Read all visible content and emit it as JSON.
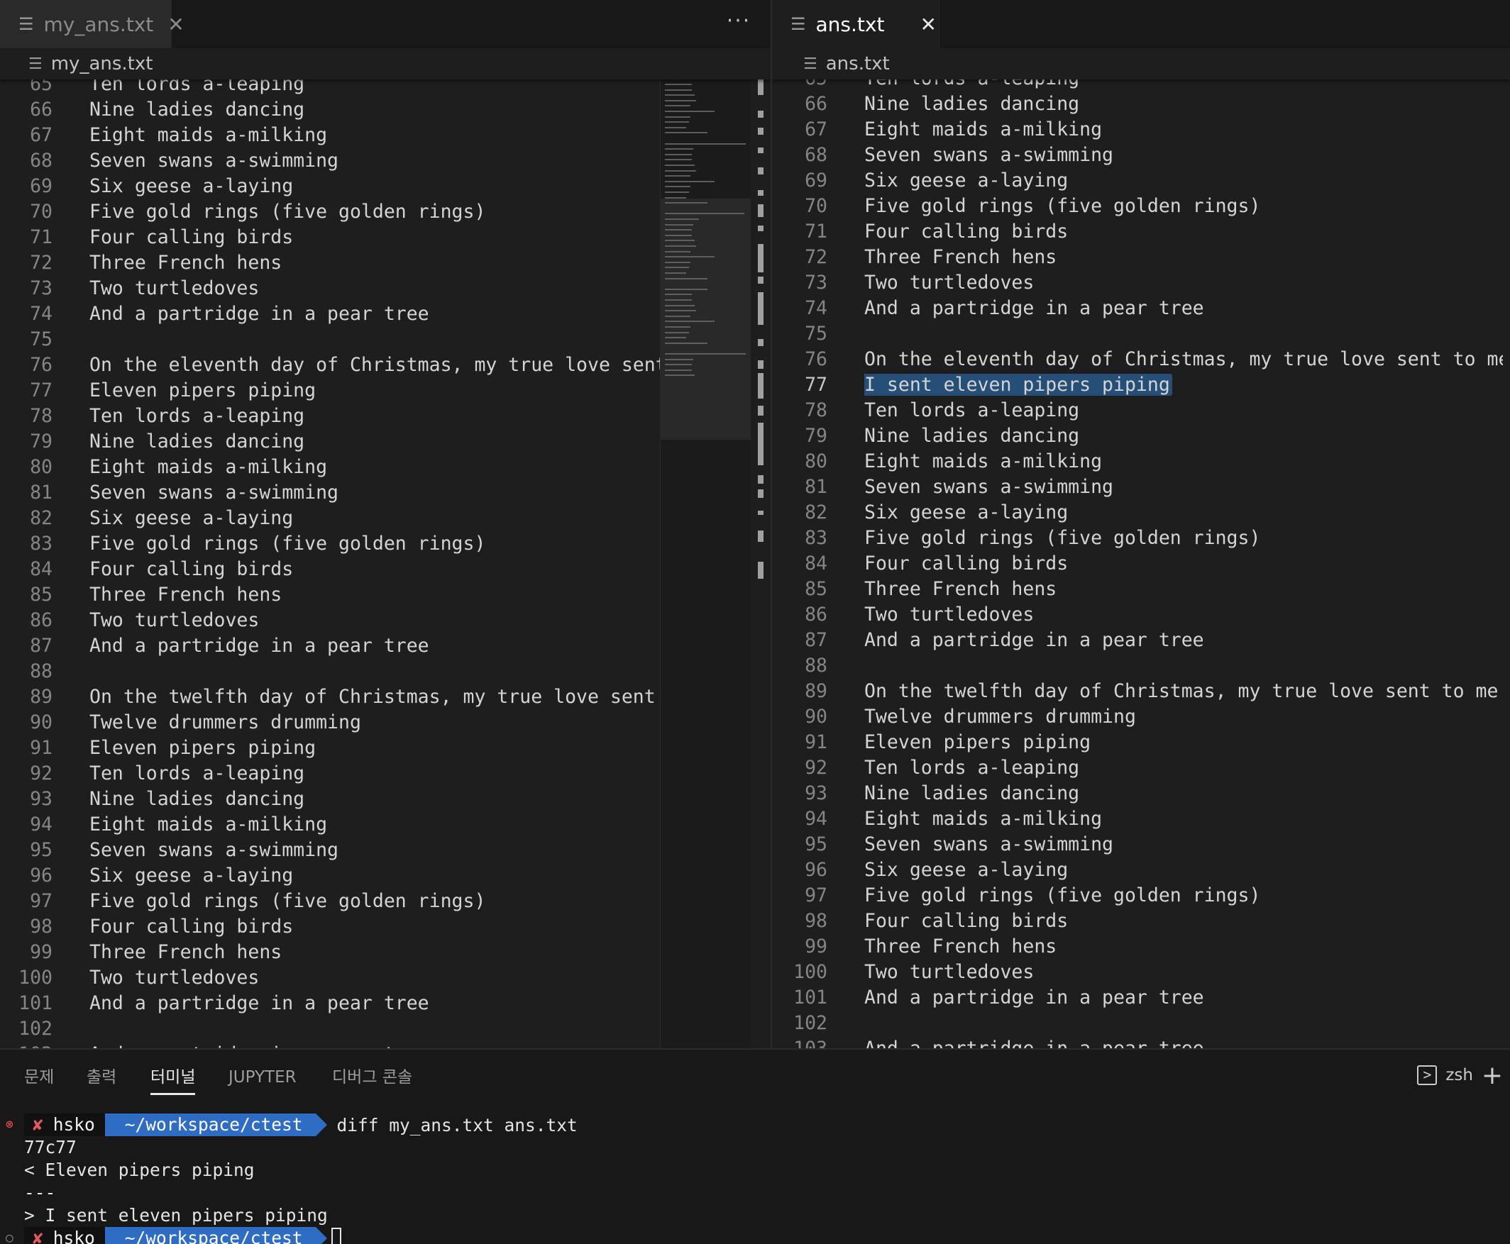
{
  "left": {
    "tab": {
      "filename": "my_ans.txt"
    },
    "breadcrumb": "my_ans.txt",
    "more_label": "···",
    "lines": [
      {
        "n": "65",
        "t": "Ten lords a-leaping"
      },
      {
        "n": "66",
        "t": "Nine ladies dancing"
      },
      {
        "n": "67",
        "t": "Eight maids a-milking"
      },
      {
        "n": "68",
        "t": "Seven swans a-swimming"
      },
      {
        "n": "69",
        "t": "Six geese a-laying"
      },
      {
        "n": "70",
        "t": "Five gold rings (five golden rings)"
      },
      {
        "n": "71",
        "t": "Four calling birds"
      },
      {
        "n": "72",
        "t": "Three French hens"
      },
      {
        "n": "73",
        "t": "Two turtledoves"
      },
      {
        "n": "74",
        "t": "And a partridge in a pear tree"
      },
      {
        "n": "75",
        "t": ""
      },
      {
        "n": "76",
        "t": "On the eleventh day of Christmas, my true love sent to me"
      },
      {
        "n": "77",
        "t": "Eleven pipers piping"
      },
      {
        "n": "78",
        "t": "Ten lords a-leaping"
      },
      {
        "n": "79",
        "t": "Nine ladies dancing"
      },
      {
        "n": "80",
        "t": "Eight maids a-milking"
      },
      {
        "n": "81",
        "t": "Seven swans a-swimming"
      },
      {
        "n": "82",
        "t": "Six geese a-laying"
      },
      {
        "n": "83",
        "t": "Five gold rings (five golden rings)"
      },
      {
        "n": "84",
        "t": "Four calling birds"
      },
      {
        "n": "85",
        "t": "Three French hens"
      },
      {
        "n": "86",
        "t": "Two turtledoves"
      },
      {
        "n": "87",
        "t": "And a partridge in a pear tree"
      },
      {
        "n": "88",
        "t": ""
      },
      {
        "n": "89",
        "t": "On the twelfth day of Christmas, my true love sent to me"
      },
      {
        "n": "90",
        "t": "Twelve drummers drumming"
      },
      {
        "n": "91",
        "t": "Eleven pipers piping"
      },
      {
        "n": "92",
        "t": "Ten lords a-leaping"
      },
      {
        "n": "93",
        "t": "Nine ladies dancing"
      },
      {
        "n": "94",
        "t": "Eight maids a-milking"
      },
      {
        "n": "95",
        "t": "Seven swans a-swimming"
      },
      {
        "n": "96",
        "t": "Six geese a-laying"
      },
      {
        "n": "97",
        "t": "Five gold rings (five golden rings)"
      },
      {
        "n": "98",
        "t": "Four calling birds"
      },
      {
        "n": "99",
        "t": "Three French hens"
      },
      {
        "n": "100",
        "t": "Two turtledoves"
      },
      {
        "n": "101",
        "t": "And a partridge in a pear tree"
      },
      {
        "n": "102",
        "t": ""
      },
      {
        "n": "103",
        "t": "And a partridge in a pear tree"
      }
    ]
  },
  "right": {
    "tab": {
      "filename": "ans.txt"
    },
    "breadcrumb": "ans.txt",
    "active_line": "77",
    "highlight_text": "I sent eleven pipers piping",
    "lines": [
      {
        "n": "65",
        "t": "Ten lords a-leaping"
      },
      {
        "n": "66",
        "t": "Nine ladies dancing"
      },
      {
        "n": "67",
        "t": "Eight maids a-milking"
      },
      {
        "n": "68",
        "t": "Seven swans a-swimming"
      },
      {
        "n": "69",
        "t": "Six geese a-laying"
      },
      {
        "n": "70",
        "t": "Five gold rings (five golden rings)"
      },
      {
        "n": "71",
        "t": "Four calling birds"
      },
      {
        "n": "72",
        "t": "Three French hens"
      },
      {
        "n": "73",
        "t": "Two turtledoves"
      },
      {
        "n": "74",
        "t": "And a partridge in a pear tree"
      },
      {
        "n": "75",
        "t": ""
      },
      {
        "n": "76",
        "t": "On the eleventh day of Christmas, my true love sent to me"
      },
      {
        "n": "77",
        "t": "I sent eleven pipers piping"
      },
      {
        "n": "78",
        "t": "Ten lords a-leaping"
      },
      {
        "n": "79",
        "t": "Nine ladies dancing"
      },
      {
        "n": "80",
        "t": "Eight maids a-milking"
      },
      {
        "n": "81",
        "t": "Seven swans a-swimming"
      },
      {
        "n": "82",
        "t": "Six geese a-laying"
      },
      {
        "n": "83",
        "t": "Five gold rings (five golden rings)"
      },
      {
        "n": "84",
        "t": "Four calling birds"
      },
      {
        "n": "85",
        "t": "Three French hens"
      },
      {
        "n": "86",
        "t": "Two turtledoves"
      },
      {
        "n": "87",
        "t": "And a partridge in a pear tree"
      },
      {
        "n": "88",
        "t": ""
      },
      {
        "n": "89",
        "t": "On the twelfth day of Christmas, my true love sent to me"
      },
      {
        "n": "90",
        "t": "Twelve drummers drumming"
      },
      {
        "n": "91",
        "t": "Eleven pipers piping"
      },
      {
        "n": "92",
        "t": "Ten lords a-leaping"
      },
      {
        "n": "93",
        "t": "Nine ladies dancing"
      },
      {
        "n": "94",
        "t": "Eight maids a-milking"
      },
      {
        "n": "95",
        "t": "Seven swans a-swimming"
      },
      {
        "n": "96",
        "t": "Six geese a-laying"
      },
      {
        "n": "97",
        "t": "Five gold rings (five golden rings)"
      },
      {
        "n": "98",
        "t": "Four calling birds"
      },
      {
        "n": "99",
        "t": "Three French hens"
      },
      {
        "n": "100",
        "t": "Two turtledoves"
      },
      {
        "n": "101",
        "t": "And a partridge in a pear tree"
      },
      {
        "n": "102",
        "t": ""
      },
      {
        "n": "103",
        "t": "And a partridge in a pear tree"
      }
    ]
  },
  "panel": {
    "tabs": [
      "문제",
      "출력",
      "터미널",
      "JUPYTER",
      "디버그 콘솔"
    ],
    "active_tab": "터미널",
    "shell_name": "zsh",
    "shell_icon_glyph": ">",
    "new_terminal_glyph": "+"
  },
  "terminal": {
    "user": "hsko",
    "status_glyph": "✘",
    "cwd": "~/workspace/ctest",
    "command": "diff my_ans.txt ans.txt",
    "output": [
      "77c77",
      "< Eleven pipers piping",
      "---",
      "> I sent eleven pipers piping"
    ],
    "error_marker": "⊗",
    "idle_marker": "○"
  },
  "colors": {
    "editor_bg": "#1e1e1e",
    "selection": "#264f78",
    "prompt_dir_bg": "#2f6cc4",
    "error_red": "#f14c4c"
  }
}
